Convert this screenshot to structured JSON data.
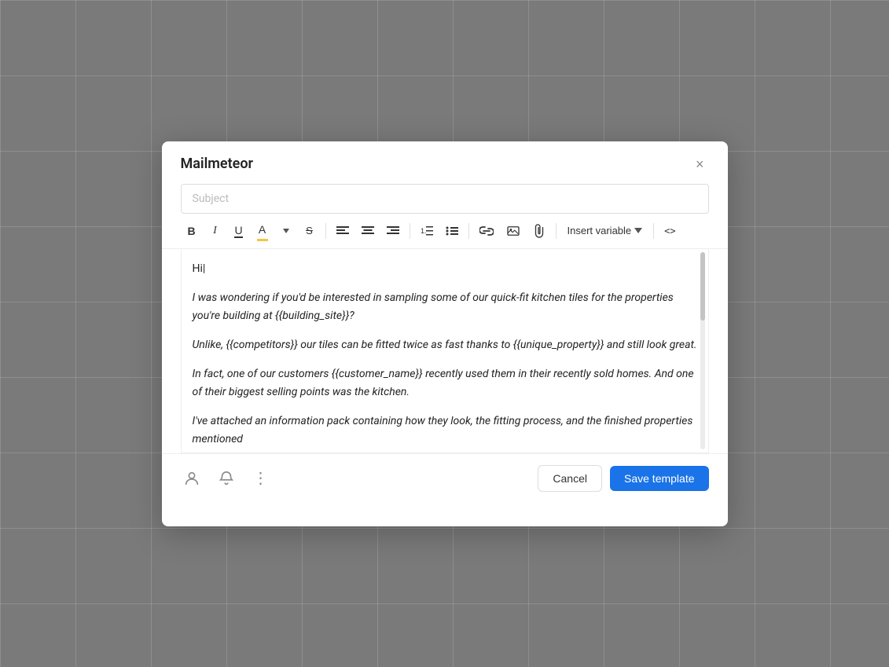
{
  "modal": {
    "title": "Mailmeteor",
    "close_label": "×",
    "subject_placeholder": "Subject"
  },
  "toolbar": {
    "bold_label": "B",
    "italic_label": "I",
    "underline_label": "U",
    "text_color_label": "A",
    "strikethrough_label": "S",
    "align_left_label": "≡",
    "align_center_label": "≡",
    "align_right_label": "≡",
    "list_ordered_label": "ol",
    "list_unordered_label": "ul",
    "link_label": "🔗",
    "image_label": "🖼",
    "attachment_label": "📎",
    "insert_variable_label": "Insert variable",
    "code_label": "<>"
  },
  "editor": {
    "paragraphs": [
      "Hi|",
      "I was wondering if you'd be interested in sampling some of our quick-fit kitchen tiles for the properties you're building at {{building_site}}?",
      "Unlike, {{competitors}} our tiles can be fitted twice as fast thanks to {{unique_property}} and still look great.",
      "In fact, one of our customers {{customer_name}} recently used them in their recently sold homes. And one of their biggest selling points was the kitchen.",
      "I've attached an information pack containing how they look, the fitting process, and the finished properties mentioned"
    ]
  },
  "footer": {
    "person_icon": "👤",
    "bell_icon": "🔔",
    "more_icon": "⋮",
    "cancel_label": "Cancel",
    "save_template_label": "Save template"
  },
  "colors": {
    "primary_blue": "#1a73e8",
    "cancel_border": "#dddddd"
  }
}
